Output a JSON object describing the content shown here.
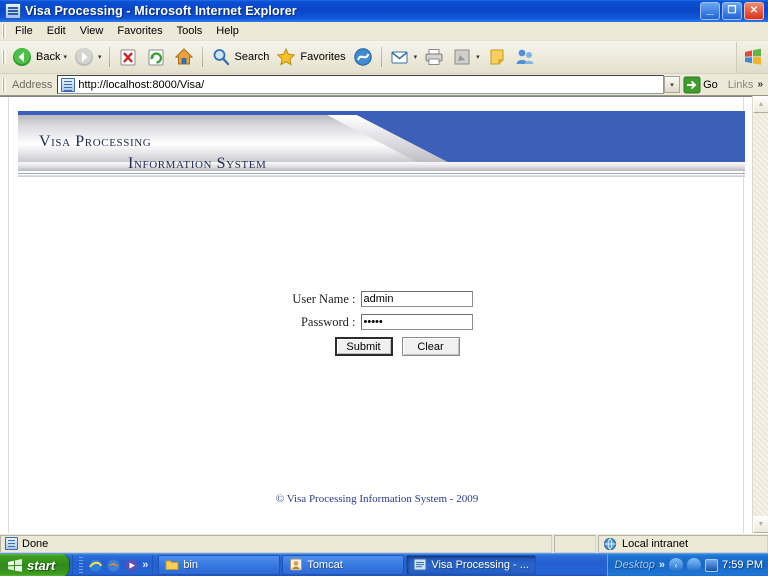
{
  "window": {
    "title": "Visa Processing - Microsoft Internet Explorer",
    "title_icon": "ie-page-icon",
    "minimize_label": "_",
    "restore_label": "❐",
    "close_label": "✕"
  },
  "menu": {
    "items": [
      {
        "label": "File"
      },
      {
        "label": "Edit"
      },
      {
        "label": "View"
      },
      {
        "label": "Favorites"
      },
      {
        "label": "Tools"
      },
      {
        "label": "Help"
      }
    ]
  },
  "toolbar": {
    "back_label": "Back",
    "back_caret": "▾",
    "forward_caret": "▾",
    "search_label": "Search",
    "favorites_label": "Favorites",
    "mail_caret": "▾",
    "edit_caret": "▾",
    "icons": {
      "back": "back-arrow-icon",
      "forward": "forward-arrow-icon",
      "stop": "stop-icon",
      "refresh": "refresh-icon",
      "home": "home-icon",
      "search": "search-icon",
      "favorites": "star-icon",
      "media": "media-icon",
      "mail": "mail-icon",
      "print": "printer-icon",
      "edit": "edit-icon",
      "notes": "notes-icon",
      "messenger": "messenger-icon",
      "brand": "windows-flag-icon"
    }
  },
  "address": {
    "label": "Address",
    "url": "http://localhost:8000/Visa/",
    "dropdown_caret": "▾",
    "go_label": "Go",
    "links_label": "Links",
    "links_chevron": "»"
  },
  "banner": {
    "line1": "Visa Processing",
    "line2": "Information System",
    "blue": "#3c60b8"
  },
  "login": {
    "username_label": "User Name :",
    "username_value": "admin",
    "password_label": "Password :",
    "password_value": "admin",
    "submit_label": "Submit",
    "clear_label": "Clear"
  },
  "footer": {
    "copyright": "© Visa Processing Information System - 2009"
  },
  "scrollbar": {
    "up_arrow": "▲",
    "down_arrow": "▼"
  },
  "status": {
    "message": "Done",
    "zone": "Local intranet"
  },
  "taskbar": {
    "start_label": "start",
    "quick_launch": [
      {
        "name": "ie-quicklaunch-icon"
      },
      {
        "name": "firefox-quicklaunch-icon"
      },
      {
        "name": "media-quicklaunch-icon"
      }
    ],
    "quick_chevron": "»",
    "items": [
      {
        "label": "bin",
        "icon": "folder-icon",
        "active": false
      },
      {
        "label": "Tomcat",
        "icon": "tomcat-icon",
        "active": false
      },
      {
        "label": "Visa Processing - ...",
        "icon": "ie-icon",
        "active": true
      }
    ],
    "tray": {
      "desktop_label": "Desktop",
      "chevron": "»",
      "show_hidden": "‹",
      "time": "7:59 PM"
    }
  }
}
